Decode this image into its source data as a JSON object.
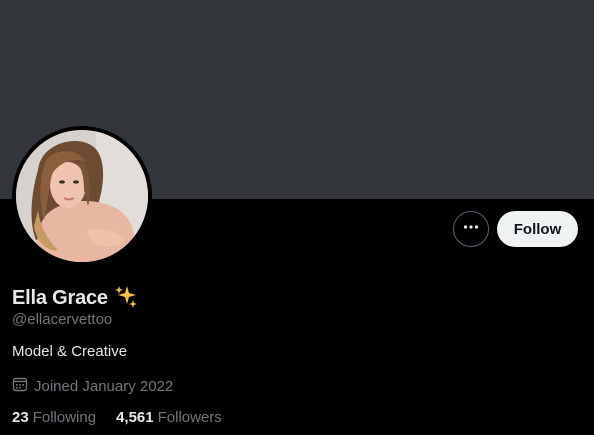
{
  "profile": {
    "display_name": "Ella Grace",
    "name_emoji": "✨",
    "handle": "@ellacervettoo",
    "bio": "Model & Creative",
    "joined": "Joined January 2022",
    "following_count": "23",
    "following_label": "Following",
    "followers_count": "4,561",
    "followers_label": "Followers"
  },
  "actions": {
    "follow_label": "Follow",
    "more_icon": "more-icon"
  },
  "icons": {
    "calendar": "calendar-icon",
    "sparkles": "sparkles-icon"
  },
  "colors": {
    "background": "#000000",
    "banner": "#33363b",
    "primary_text": "#e7e9ea",
    "secondary_text": "#71767b",
    "follow_button_bg": "#eff3f4",
    "follow_button_text": "#0f1419"
  }
}
